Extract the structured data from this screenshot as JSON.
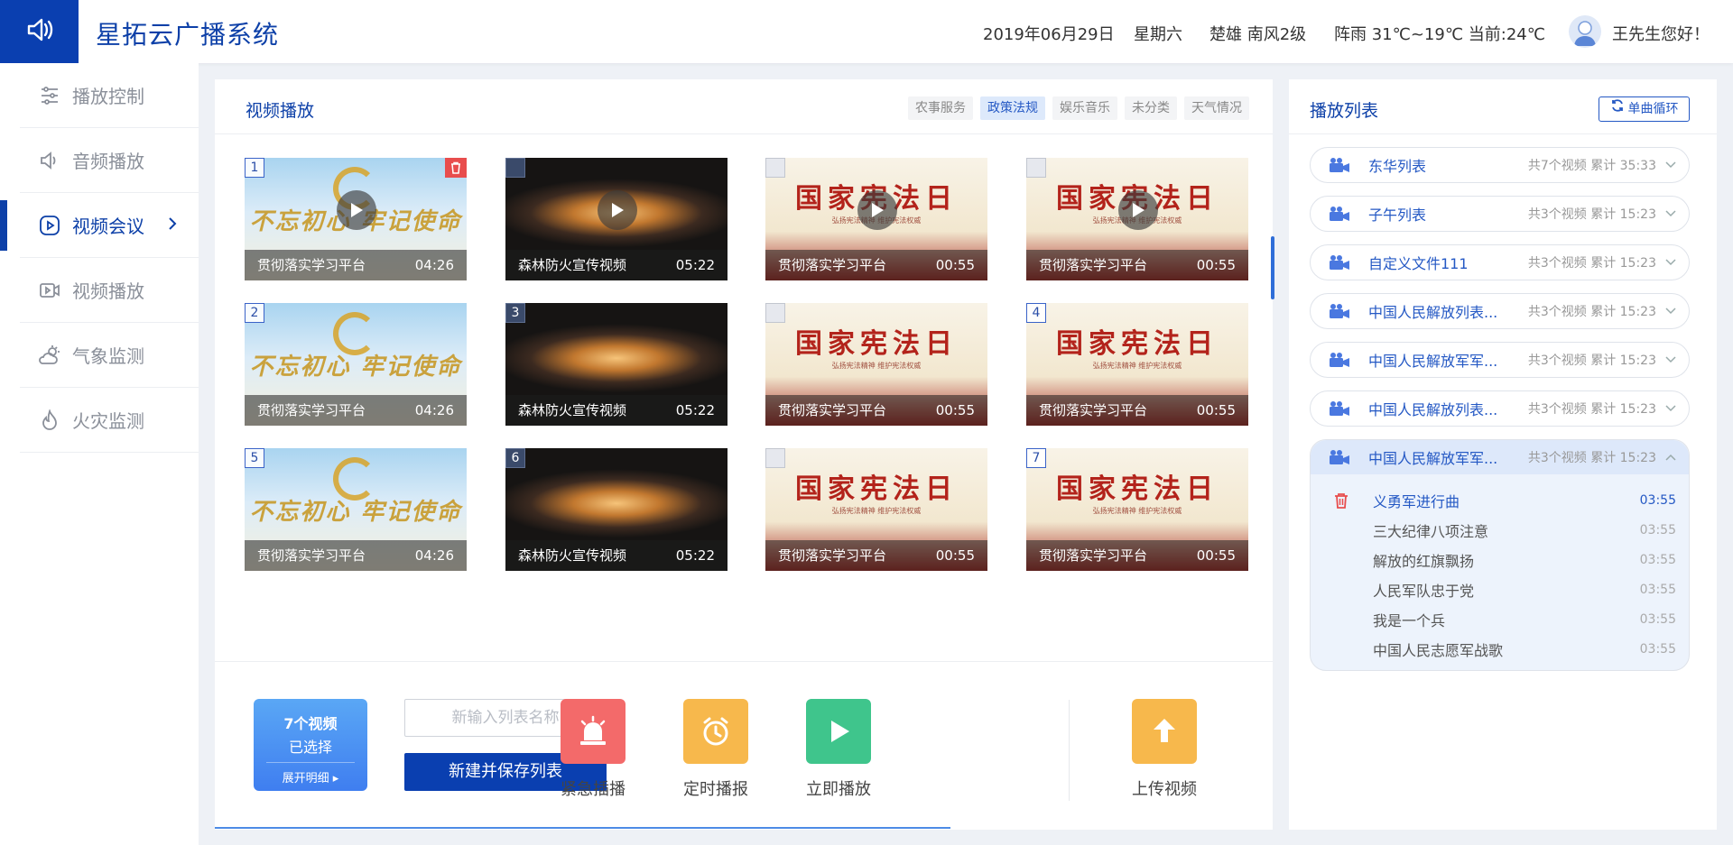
{
  "header": {
    "app_title": "星拓云广播系统",
    "date": "2019年06月29日",
    "weekday": "星期六",
    "wind": "楚雄 南风2级",
    "weather": "阵雨 31℃~19℃ 当前:24℃",
    "greeting": "王先生您好！"
  },
  "sidebar": {
    "items": [
      {
        "label": "播放控制",
        "icon": "sliders-icon"
      },
      {
        "label": "音频播放",
        "icon": "speaker-icon"
      },
      {
        "label": "视频会议",
        "icon": "play-circle-icon",
        "active": true
      },
      {
        "label": "视频播放",
        "icon": "video-icon"
      },
      {
        "label": "气象监测",
        "icon": "weather-icon"
      },
      {
        "label": "火灾监测",
        "icon": "fire-icon"
      }
    ]
  },
  "main": {
    "title": "视频播放",
    "tabs": [
      {
        "label": "农事服务"
      },
      {
        "label": "政策法规",
        "active": true
      },
      {
        "label": "娱乐音乐"
      },
      {
        "label": "未分类"
      },
      {
        "label": "天气情况"
      }
    ],
    "videos": [
      {
        "index": "1",
        "title": "贯彻落实学习平台",
        "duration": "04:26",
        "thumb": "party",
        "play": true,
        "delete": true
      },
      {
        "index": "",
        "title": "森林防火宣传视频",
        "duration": "05:22",
        "thumb": "fire",
        "play": true,
        "box": "dark"
      },
      {
        "index": "",
        "title": "贯彻落实学习平台",
        "duration": "00:55",
        "thumb": "const",
        "play": true,
        "box": "empty"
      },
      {
        "index": "",
        "title": "贯彻落实学习平台",
        "duration": "00:55",
        "thumb": "const",
        "play": true,
        "box": "empty"
      },
      {
        "index": "2",
        "title": "贯彻落实学习平台",
        "duration": "04:26",
        "thumb": "party"
      },
      {
        "index": "3",
        "title": "森林防火宣传视频",
        "duration": "05:22",
        "thumb": "fire",
        "box": "dark"
      },
      {
        "index": "",
        "title": "贯彻落实学习平台",
        "duration": "00:55",
        "thumb": "const",
        "box": "empty"
      },
      {
        "index": "4",
        "title": "贯彻落实学习平台",
        "duration": "00:55",
        "thumb": "const"
      },
      {
        "index": "5",
        "title": "贯彻落实学习平台",
        "duration": "04:26",
        "thumb": "party"
      },
      {
        "index": "6",
        "title": "森林防火宣传视频",
        "duration": "05:22",
        "thumb": "fire",
        "box": "dark"
      },
      {
        "index": "",
        "title": "贯彻落实学习平台",
        "duration": "00:55",
        "thumb": "const",
        "box": "empty"
      },
      {
        "index": "7",
        "title": "贯彻落实学习平台",
        "duration": "00:55",
        "thumb": "const"
      }
    ],
    "thumb_text": {
      "party": "不忘初心 牢记使命",
      "const": "国家宪法日",
      "const_sub": "弘扬宪法精神 维护宪法权威"
    },
    "selection": {
      "count": "7个视频",
      "status": "已选择",
      "detail": "展开明细 ▸"
    },
    "new_list_placeholder": "新输入列表名称",
    "save_button": "新建并保存列表",
    "actions": {
      "emergency": "紧急插播",
      "scheduled": "定时播报",
      "play_now": "立即播放",
      "upload": "上传视频"
    },
    "colors": {
      "emergency": "#f36a6a",
      "scheduled": "#f7b84c",
      "play_now": "#3fc58c",
      "upload": "#f7b84c"
    }
  },
  "playlist": {
    "title": "播放列表",
    "loop_button": "单曲循环",
    "lists": [
      {
        "name": "东华列表",
        "meta": "共7个视频 累计 35:33"
      },
      {
        "name": "子午列表",
        "meta": "共3个视频 累计 15:23"
      },
      {
        "name": "自定义文件111",
        "meta": "共3个视频 累计 15:23"
      },
      {
        "name": "中国人民解放列表...",
        "meta": "共3个视频 累计 15:23"
      },
      {
        "name": "中国人民解放军军...",
        "meta": "共3个视频 累计 15:23"
      },
      {
        "name": "中国人民解放列表...",
        "meta": "共3个视频 累计 15:23"
      }
    ],
    "expanded": {
      "name": "中国人民解放军军...",
      "meta": "共3个视频 累计 15:23",
      "items": [
        {
          "title": "义勇军进行曲",
          "duration": "03:55",
          "playing": true
        },
        {
          "title": "三大纪律八项注意",
          "duration": "03:55"
        },
        {
          "title": "解放的红旗飘扬",
          "duration": "03:55"
        },
        {
          "title": "人民军队忠于党",
          "duration": "03:55"
        },
        {
          "title": "我是一个兵",
          "duration": "03:55"
        },
        {
          "title": "中国人民志愿军战歌",
          "duration": "03:55"
        }
      ]
    }
  }
}
